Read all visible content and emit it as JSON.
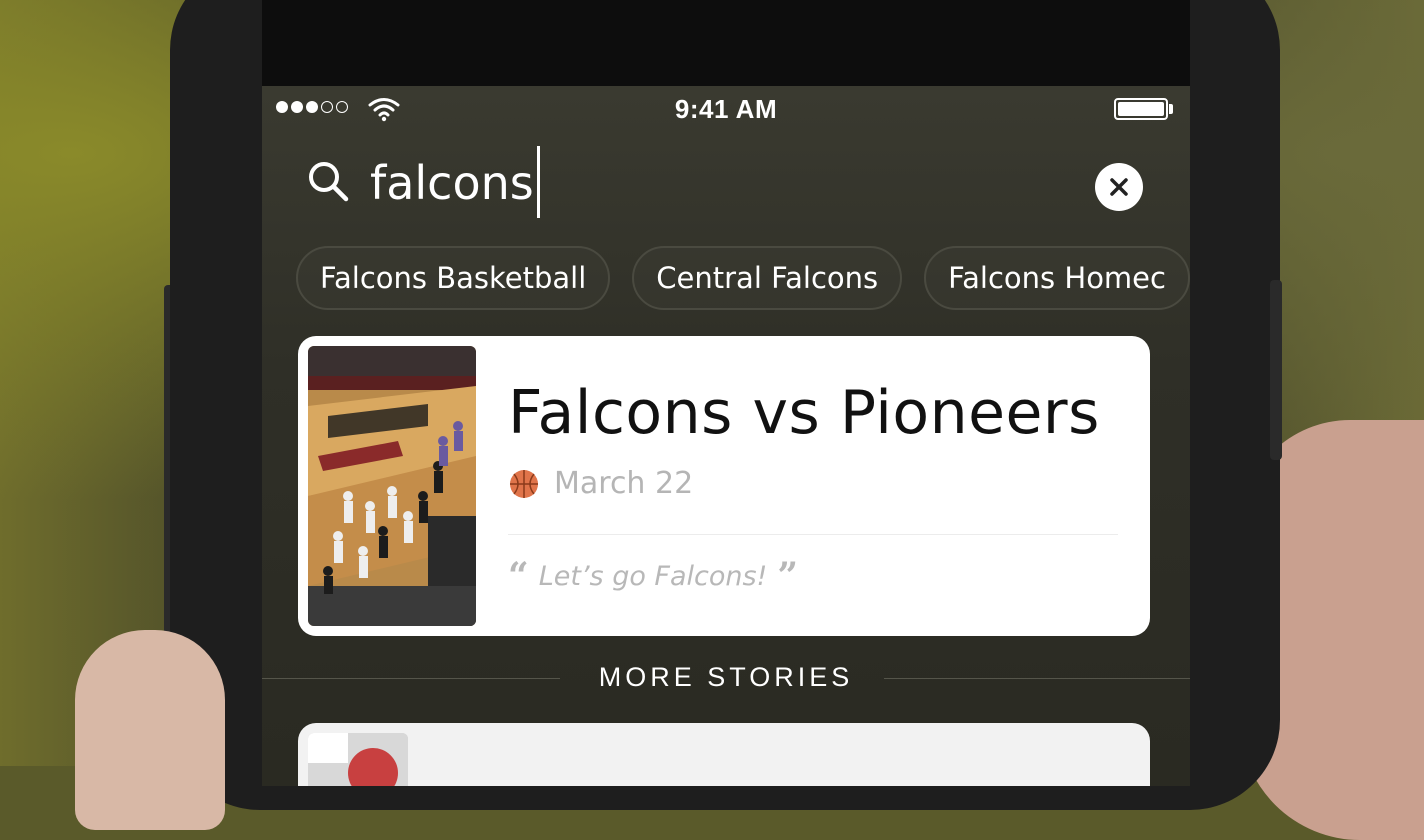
{
  "status_bar": {
    "time": "9:41 AM",
    "signal_filled": 3,
    "signal_total": 5,
    "battery_level": 1.0
  },
  "search": {
    "query": "falcons",
    "search_icon": "search-icon",
    "clear_icon": "close-icon"
  },
  "suggestions": [
    {
      "label": "Falcons Basketball"
    },
    {
      "label": "Central Falcons"
    },
    {
      "label": "Falcons Homec"
    }
  ],
  "featured_story": {
    "title": "Falcons vs Pioneers",
    "date": "March 22",
    "date_icon": "basketball-icon",
    "quote": "Let’s go Falcons!",
    "quote_open": "“",
    "quote_close": "”"
  },
  "more_stories": {
    "heading": "MORE STORIES"
  },
  "colors": {
    "card_bg": "#ffffff",
    "secondary_text": "#b5b5b5",
    "screen_bg": "#2f2f27"
  }
}
